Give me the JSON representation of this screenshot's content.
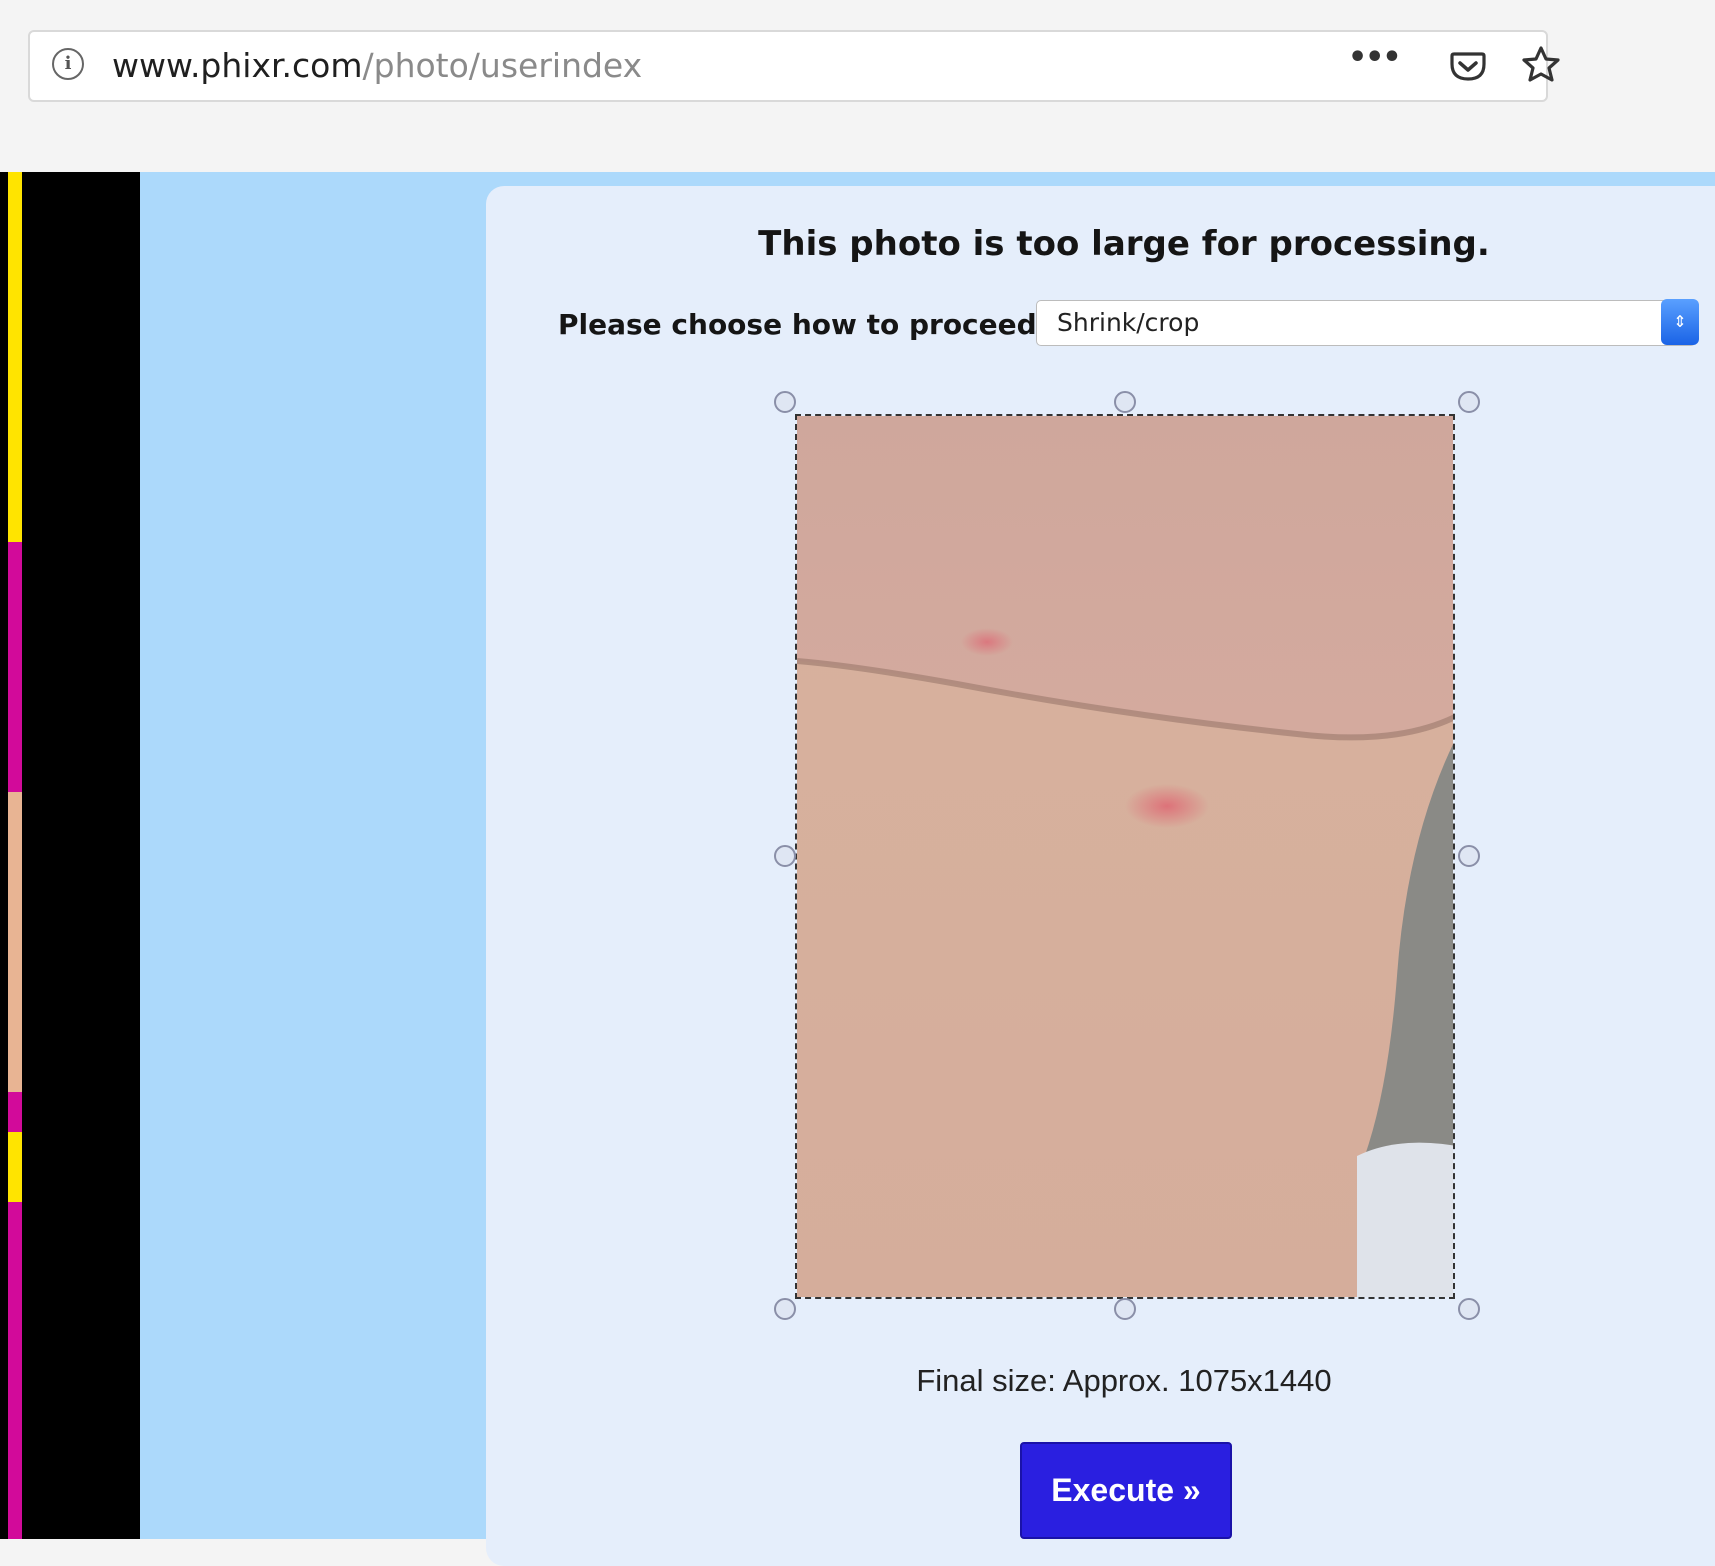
{
  "browser": {
    "url_host": "www.phixr.com",
    "url_path": "/photo/userindex",
    "icons": [
      "info-icon",
      "more-icon",
      "pocket-icon",
      "star-icon"
    ]
  },
  "dialog": {
    "title": "This photo is too large for processing.",
    "choose_label": "Please choose how to proceed:",
    "select_value": "Shrink/crop",
    "final_size": "Final size: Approx. 1075x1440",
    "execute_label": "Execute »"
  },
  "colors": {
    "page_bg": "#acd9fb",
    "panel_bg": "#e5eefb",
    "button_bg": "#2a1fe0"
  }
}
